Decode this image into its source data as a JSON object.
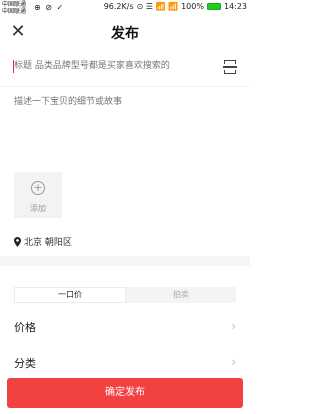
{
  "status_bar": {
    "carrier_1": "中国联通",
    "carrier_2": "中国联通",
    "left_icons": "⊕ ⊘ ✓",
    "speed": "96.2K/s",
    "signal": "⊙ ☰ 📶 📶",
    "battery_percent": "100%",
    "time": "14:23"
  },
  "nav": {
    "close_glyph": "✕",
    "title": "发布"
  },
  "form": {
    "title_placeholder": "标题 品类品牌型号都是买家喜欢搜索的",
    "description_placeholder": "描述一下宝贝的细节或故事",
    "add_photo_label": "添加",
    "add_glyph": "+",
    "location_text": "北京 朝阳区"
  },
  "pricing_tabs": [
    {
      "label": "一口价",
      "active": true
    },
    {
      "label": "拍卖",
      "active": false
    }
  ],
  "rows": {
    "price_label": "价格",
    "category_label": "分类",
    "chevron": "›"
  },
  "publish_button": {
    "label": "确定发布",
    "color": "#f24141"
  }
}
